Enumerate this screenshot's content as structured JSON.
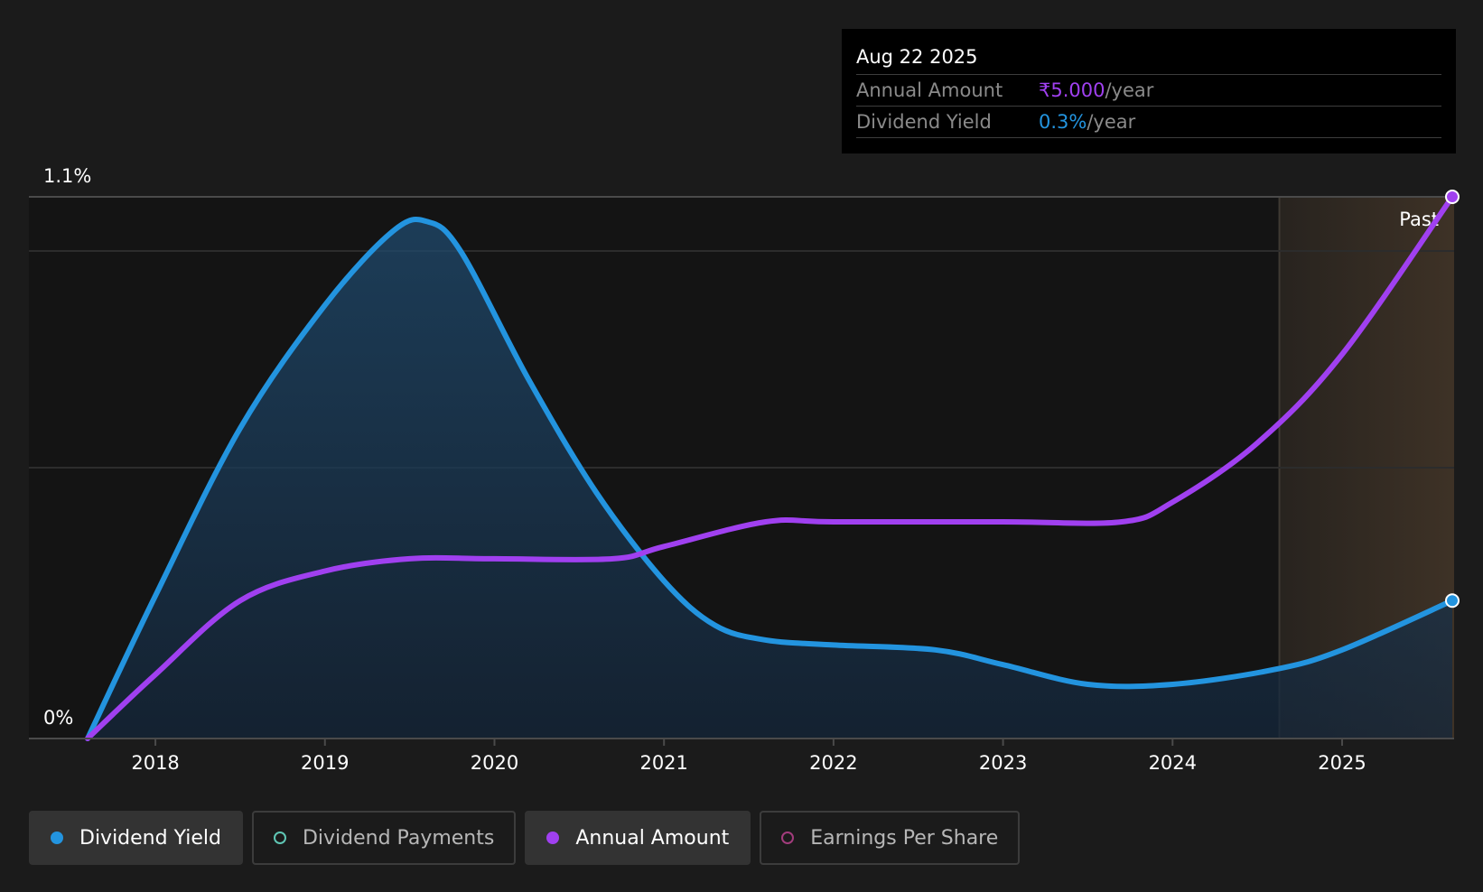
{
  "chart_data": {
    "type": "line",
    "x_axis": {
      "ticks": [
        "2018",
        "2019",
        "2020",
        "2021",
        "2022",
        "2023",
        "2024",
        "2025"
      ],
      "range": [
        2017.6,
        2025.65
      ]
    },
    "y_axis": {
      "tick_labels": [
        "0%",
        "1.1%"
      ],
      "range": [
        0,
        1.1
      ]
    },
    "series": [
      {
        "name": "Dividend Yield",
        "color": "#2394df",
        "fill": true,
        "points": [
          [
            2017.6,
            0.0
          ],
          [
            2018.0,
            0.29
          ],
          [
            2018.5,
            0.63
          ],
          [
            2019.0,
            0.88
          ],
          [
            2019.4,
            1.03
          ],
          [
            2019.6,
            1.05
          ],
          [
            2019.8,
            0.99
          ],
          [
            2020.2,
            0.73
          ],
          [
            2020.6,
            0.5
          ],
          [
            2021.0,
            0.32
          ],
          [
            2021.3,
            0.23
          ],
          [
            2021.6,
            0.2
          ],
          [
            2022.0,
            0.19
          ],
          [
            2022.6,
            0.18
          ],
          [
            2023.0,
            0.15
          ],
          [
            2023.5,
            0.11
          ],
          [
            2024.0,
            0.11
          ],
          [
            2024.6,
            0.14
          ],
          [
            2025.0,
            0.18
          ],
          [
            2025.65,
            0.28
          ]
        ]
      },
      {
        "name": "Annual Amount",
        "color": "#a040f0",
        "fill": false,
        "points": [
          [
            2017.6,
            0.0
          ],
          [
            2018.0,
            0.13
          ],
          [
            2018.5,
            0.28
          ],
          [
            2019.0,
            0.34
          ],
          [
            2019.5,
            0.365
          ],
          [
            2020.0,
            0.365
          ],
          [
            2020.7,
            0.365
          ],
          [
            2021.0,
            0.39
          ],
          [
            2021.6,
            0.44
          ],
          [
            2022.0,
            0.44
          ],
          [
            2023.0,
            0.44
          ],
          [
            2023.7,
            0.44
          ],
          [
            2024.0,
            0.48
          ],
          [
            2024.5,
            0.6
          ],
          [
            2025.0,
            0.78
          ],
          [
            2025.65,
            1.1
          ]
        ]
      }
    ],
    "forecast_region": {
      "start": 2024.63,
      "label": "Past"
    },
    "legend": [
      {
        "name": "Dividend Yield",
        "color": "#2394df",
        "active": true,
        "style": "filled"
      },
      {
        "name": "Dividend Payments",
        "color": "#5fc6b4",
        "active": false,
        "style": "hollow"
      },
      {
        "name": "Annual Amount",
        "color": "#a040f0",
        "active": true,
        "style": "filled"
      },
      {
        "name": "Earnings Per Share",
        "color": "#a23c7c",
        "active": false,
        "style": "hollow"
      }
    ]
  },
  "tooltip": {
    "date": "Aug 22 2025",
    "annual_amount_label": "Annual Amount",
    "annual_amount_value": "₹5.000",
    "dividend_yield_label": "Dividend Yield",
    "dividend_yield_value": "0.3%",
    "unit": "/year"
  }
}
